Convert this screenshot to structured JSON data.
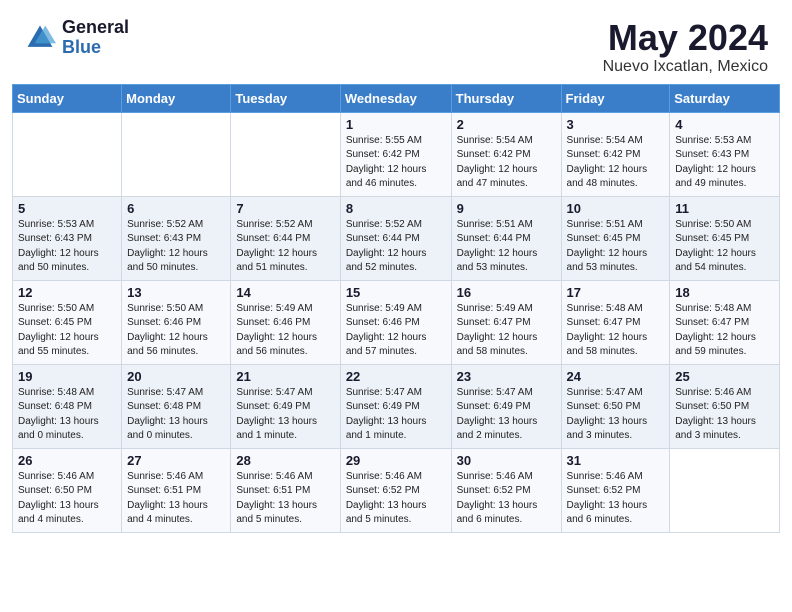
{
  "logo": {
    "general": "General",
    "blue": "Blue"
  },
  "title": {
    "month_year": "May 2024",
    "location": "Nuevo Ixcatlan, Mexico"
  },
  "weekdays": [
    "Sunday",
    "Monday",
    "Tuesday",
    "Wednesday",
    "Thursday",
    "Friday",
    "Saturday"
  ],
  "weeks": [
    [
      {
        "day": "",
        "detail": ""
      },
      {
        "day": "",
        "detail": ""
      },
      {
        "day": "",
        "detail": ""
      },
      {
        "day": "1",
        "detail": "Sunrise: 5:55 AM\nSunset: 6:42 PM\nDaylight: 12 hours\nand 46 minutes."
      },
      {
        "day": "2",
        "detail": "Sunrise: 5:54 AM\nSunset: 6:42 PM\nDaylight: 12 hours\nand 47 minutes."
      },
      {
        "day": "3",
        "detail": "Sunrise: 5:54 AM\nSunset: 6:42 PM\nDaylight: 12 hours\nand 48 minutes."
      },
      {
        "day": "4",
        "detail": "Sunrise: 5:53 AM\nSunset: 6:43 PM\nDaylight: 12 hours\nand 49 minutes."
      }
    ],
    [
      {
        "day": "5",
        "detail": "Sunrise: 5:53 AM\nSunset: 6:43 PM\nDaylight: 12 hours\nand 50 minutes."
      },
      {
        "day": "6",
        "detail": "Sunrise: 5:52 AM\nSunset: 6:43 PM\nDaylight: 12 hours\nand 50 minutes."
      },
      {
        "day": "7",
        "detail": "Sunrise: 5:52 AM\nSunset: 6:44 PM\nDaylight: 12 hours\nand 51 minutes."
      },
      {
        "day": "8",
        "detail": "Sunrise: 5:52 AM\nSunset: 6:44 PM\nDaylight: 12 hours\nand 52 minutes."
      },
      {
        "day": "9",
        "detail": "Sunrise: 5:51 AM\nSunset: 6:44 PM\nDaylight: 12 hours\nand 53 minutes."
      },
      {
        "day": "10",
        "detail": "Sunrise: 5:51 AM\nSunset: 6:45 PM\nDaylight: 12 hours\nand 53 minutes."
      },
      {
        "day": "11",
        "detail": "Sunrise: 5:50 AM\nSunset: 6:45 PM\nDaylight: 12 hours\nand 54 minutes."
      }
    ],
    [
      {
        "day": "12",
        "detail": "Sunrise: 5:50 AM\nSunset: 6:45 PM\nDaylight: 12 hours\nand 55 minutes."
      },
      {
        "day": "13",
        "detail": "Sunrise: 5:50 AM\nSunset: 6:46 PM\nDaylight: 12 hours\nand 56 minutes."
      },
      {
        "day": "14",
        "detail": "Sunrise: 5:49 AM\nSunset: 6:46 PM\nDaylight: 12 hours\nand 56 minutes."
      },
      {
        "day": "15",
        "detail": "Sunrise: 5:49 AM\nSunset: 6:46 PM\nDaylight: 12 hours\nand 57 minutes."
      },
      {
        "day": "16",
        "detail": "Sunrise: 5:49 AM\nSunset: 6:47 PM\nDaylight: 12 hours\nand 58 minutes."
      },
      {
        "day": "17",
        "detail": "Sunrise: 5:48 AM\nSunset: 6:47 PM\nDaylight: 12 hours\nand 58 minutes."
      },
      {
        "day": "18",
        "detail": "Sunrise: 5:48 AM\nSunset: 6:47 PM\nDaylight: 12 hours\nand 59 minutes."
      }
    ],
    [
      {
        "day": "19",
        "detail": "Sunrise: 5:48 AM\nSunset: 6:48 PM\nDaylight: 13 hours\nand 0 minutes."
      },
      {
        "day": "20",
        "detail": "Sunrise: 5:47 AM\nSunset: 6:48 PM\nDaylight: 13 hours\nand 0 minutes."
      },
      {
        "day": "21",
        "detail": "Sunrise: 5:47 AM\nSunset: 6:49 PM\nDaylight: 13 hours\nand 1 minute."
      },
      {
        "day": "22",
        "detail": "Sunrise: 5:47 AM\nSunset: 6:49 PM\nDaylight: 13 hours\nand 1 minute."
      },
      {
        "day": "23",
        "detail": "Sunrise: 5:47 AM\nSunset: 6:49 PM\nDaylight: 13 hours\nand 2 minutes."
      },
      {
        "day": "24",
        "detail": "Sunrise: 5:47 AM\nSunset: 6:50 PM\nDaylight: 13 hours\nand 3 minutes."
      },
      {
        "day": "25",
        "detail": "Sunrise: 5:46 AM\nSunset: 6:50 PM\nDaylight: 13 hours\nand 3 minutes."
      }
    ],
    [
      {
        "day": "26",
        "detail": "Sunrise: 5:46 AM\nSunset: 6:50 PM\nDaylight: 13 hours\nand 4 minutes."
      },
      {
        "day": "27",
        "detail": "Sunrise: 5:46 AM\nSunset: 6:51 PM\nDaylight: 13 hours\nand 4 minutes."
      },
      {
        "day": "28",
        "detail": "Sunrise: 5:46 AM\nSunset: 6:51 PM\nDaylight: 13 hours\nand 5 minutes."
      },
      {
        "day": "29",
        "detail": "Sunrise: 5:46 AM\nSunset: 6:52 PM\nDaylight: 13 hours\nand 5 minutes."
      },
      {
        "day": "30",
        "detail": "Sunrise: 5:46 AM\nSunset: 6:52 PM\nDaylight: 13 hours\nand 6 minutes."
      },
      {
        "day": "31",
        "detail": "Sunrise: 5:46 AM\nSunset: 6:52 PM\nDaylight: 13 hours\nand 6 minutes."
      },
      {
        "day": "",
        "detail": ""
      }
    ]
  ]
}
